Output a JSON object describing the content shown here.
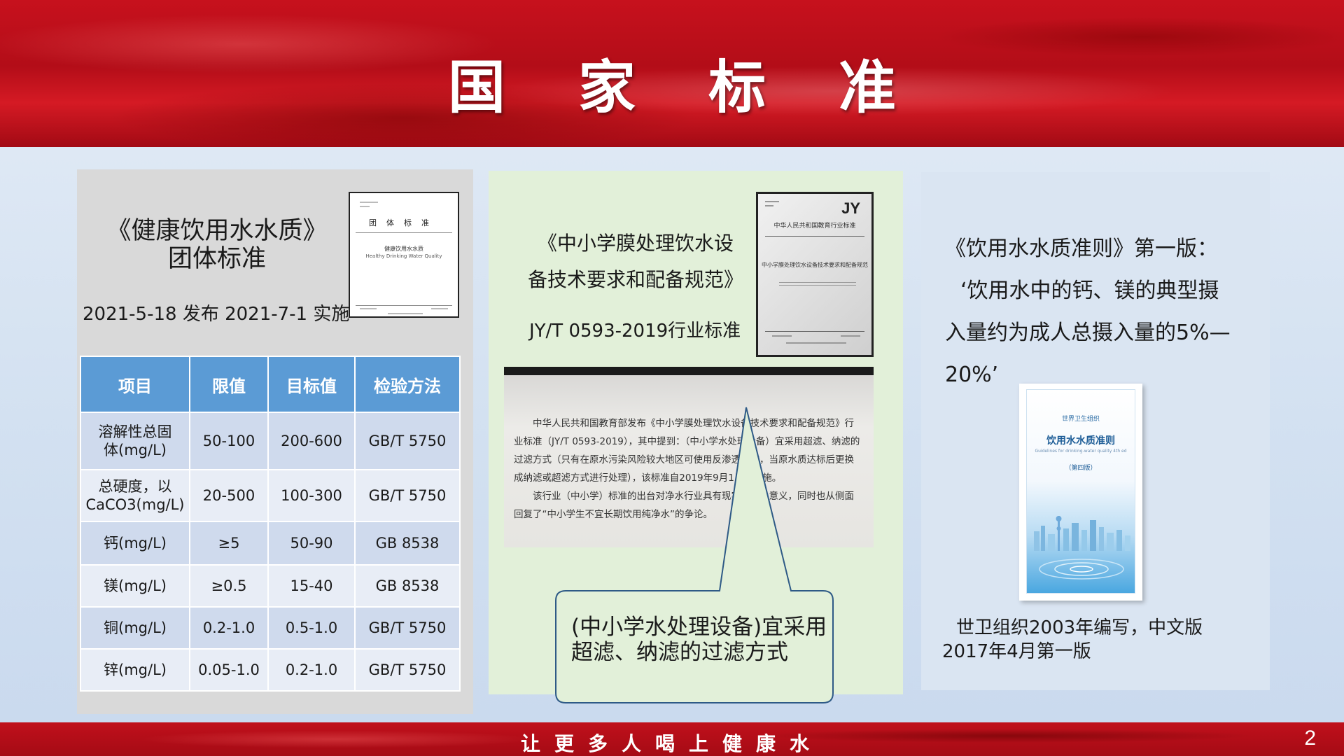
{
  "header": {
    "title": "国家标准"
  },
  "footer": {
    "slogan": "让更多人喝上健康水",
    "page_number": "2"
  },
  "panel1": {
    "title_line1": "《健康饮用水水质》",
    "title_line2": "团体标准",
    "dates": "2021-5-18 发布   2021-7-1 实施",
    "doc_thumbnail": {
      "heading": "团体标准",
      "title": "健康饮用水水质",
      "subtitle": "Healthy Drinking Water Quality"
    },
    "table": {
      "headers": [
        "项目",
        "限值",
        "目标值",
        "检验方法"
      ],
      "rows": [
        {
          "item_line1": "溶解性总固",
          "item_line2": "体(mg/L)",
          "limit": "50-100",
          "target": "200-600",
          "method": "GB/T 5750"
        },
        {
          "item_line1": "总硬度，以",
          "item_line2": "CaCO3(mg/L)",
          "limit": "20-500",
          "target": "100-300",
          "method": "GB/T 5750"
        },
        {
          "item_line1": "钙(mg/L)",
          "item_line2": "",
          "limit": "≥5",
          "target": "50-90",
          "method": "GB 8538"
        },
        {
          "item_line1": "镁(mg/L)",
          "item_line2": "",
          "limit": "≥0.5",
          "target": "15-40",
          "method": "GB 8538"
        },
        {
          "item_line1": "铜(mg/L)",
          "item_line2": "",
          "limit": "0.2-1.0",
          "target": "0.5-1.0",
          "method": "GB/T 5750"
        },
        {
          "item_line1": "锌(mg/L)",
          "item_line2": "",
          "limit": "0.05-1.0",
          "target": "0.2-1.0",
          "method": "GB/T 5750"
        }
      ]
    }
  },
  "panel2": {
    "title_line1": "《中小学膜处理饮水设",
    "title_line2": "备技术要求和配备规范》",
    "standard": "JY/T 0593-2019行业标准",
    "jy_thumbnail": {
      "mark": "JY",
      "org": "中华人民共和国教育行业标准",
      "doc_title": "中小学膜处理饮水设备技术要求和配备规范"
    },
    "excerpt_p1": "中华人民共和国教育部发布《中小学膜处理饮水设备技术要求和配备规范》行业标准（JY/T 0593-2019），其中提到：（中小学水处理设备）宜采用超滤、纳滤的过滤方式（只有在原水污染风险较大地区可使用反渗透方式，当原水质达标后更换成纳滤或超滤方式进行处理），该标准自2019年9月1日起实施。",
    "excerpt_p2": "该行业（中小学）标准的出台对净水行业具有现实的指导意义，同时也从侧面回复了“中小学生不宜长期饮用纯净水”的争论。",
    "callout": "(中小学水处理设备)宜采用超滤、纳滤的过滤方式"
  },
  "panel3": {
    "quote_line1": "《饮用水水质准则》第一版：",
    "quote_line2": "‘饮用水中的钙、镁的典型摄",
    "quote_line3": "入量约为成人总摄入量的5%—",
    "quote_line4": "20%’",
    "book": {
      "org": "世界卫生组织",
      "title": "饮用水水质准则",
      "subtitle": "Guidelines for drinking-water quality 4th ed",
      "edition": "（第四版）"
    },
    "caption_line1": "世卫组织2003年编写，中文版",
    "caption_line2": "2017年4月第一版"
  },
  "colors": {
    "header_red": "#c7111d",
    "table_header_blue": "#5b9bd5",
    "panel1_bg": "#d9d9d9",
    "panel2_bg": "#e2f0d9",
    "panel3_bg": "#dae5f2"
  }
}
